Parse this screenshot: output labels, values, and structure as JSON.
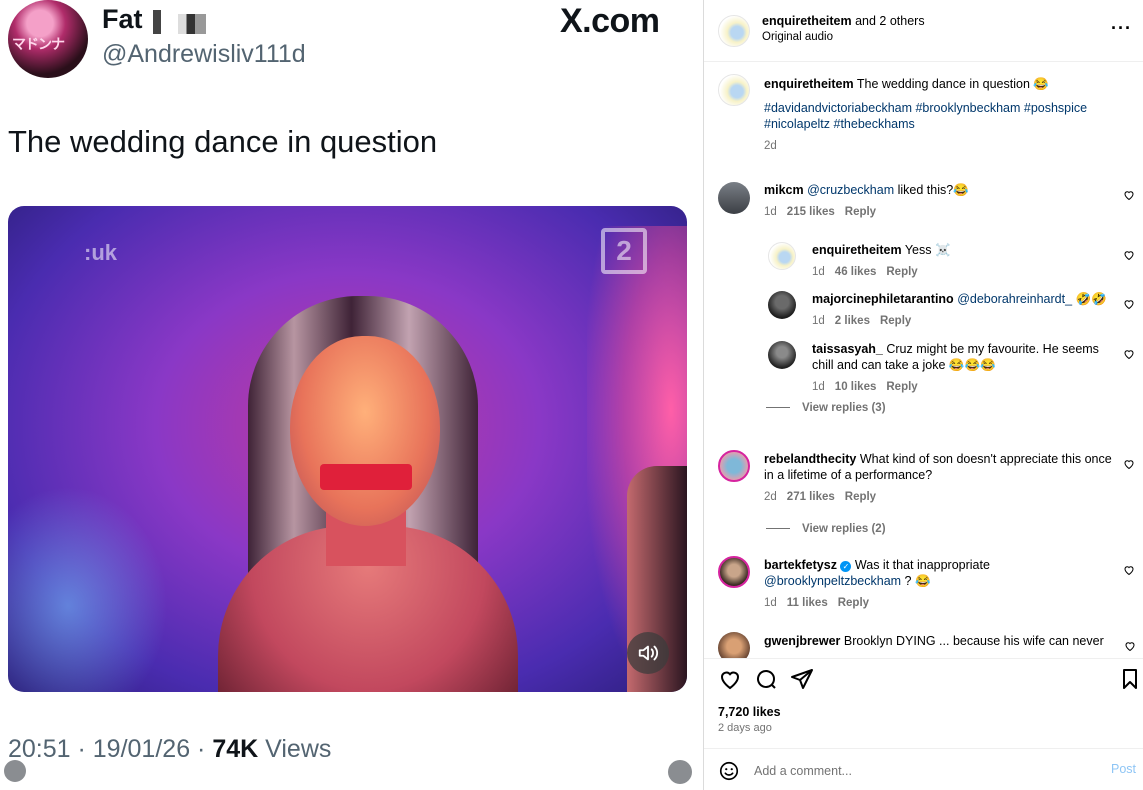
{
  "tweet": {
    "author_name": "Fat",
    "handle": "@Andrewisliv111d",
    "site": "X.com",
    "text": "The wedding dance in question",
    "time": "20:51 · 19/01/26 · ",
    "views_count": "74K",
    "views_label": " Views",
    "avatar_text": "マドンナ",
    "video_watermark_left": ":uk",
    "video_watermark_right": "2"
  },
  "instagram": {
    "header": {
      "username": "enquiretheitem",
      "and_others": " and 2 others",
      "subtitle": "Original audio"
    },
    "caption": {
      "username": "enquiretheitem",
      "text": " The wedding dance in question 😂",
      "hashtags": "#davidandvictoriabeckham #brooklynbeckham #poshspice #nicolapeltz #thebeckhams",
      "time": "2d"
    },
    "comments": [
      {
        "username": "mikcm",
        "mention": "@cruzbeckham",
        "text": " liked this?😂",
        "time": "1d",
        "likes": "215 likes",
        "reply": "Reply"
      },
      {
        "username": "enquiretheitem",
        "mention": "",
        "text": " Yess ☠️",
        "time": "1d",
        "likes": "46 likes",
        "reply": "Reply"
      },
      {
        "username": "majorcinephiletarantino",
        "mention": "@deborahreinhardt_",
        "text": " 🤣🤣",
        "time": "1d",
        "likes": "2 likes",
        "reply": "Reply"
      },
      {
        "username": "taissasyah_",
        "mention": "",
        "text": " Cruz might be my favourite. He seems chill and can take a joke 😂😂😂",
        "time": "1d",
        "likes": "10 likes",
        "reply": "Reply"
      },
      {
        "username": "rebelandthecity",
        "mention": "",
        "text": " What kind of son doesn't appreciate this once in a lifetime of a performance?",
        "time": "2d",
        "likes": "271 likes",
        "reply": "Reply"
      },
      {
        "username": "bartekfetysz",
        "mention": "@brooklynpeltzbeckham",
        "pre_text": " Was it that inappropriate ",
        "text": " ? 😂",
        "time": "1d",
        "likes": "11 likes",
        "reply": "Reply"
      },
      {
        "username": "gwenjbrewer",
        "mention": "",
        "text": " Brooklyn DYING ... because his wife can never",
        "time": "",
        "likes": "",
        "reply": ""
      }
    ],
    "view_replies_1": "View replies (3)",
    "view_replies_2": "View replies (2)",
    "likes_total": "7,720 likes",
    "posted_ago": "2 days ago",
    "comment_placeholder": "Add a comment...",
    "post_label": "Post"
  }
}
